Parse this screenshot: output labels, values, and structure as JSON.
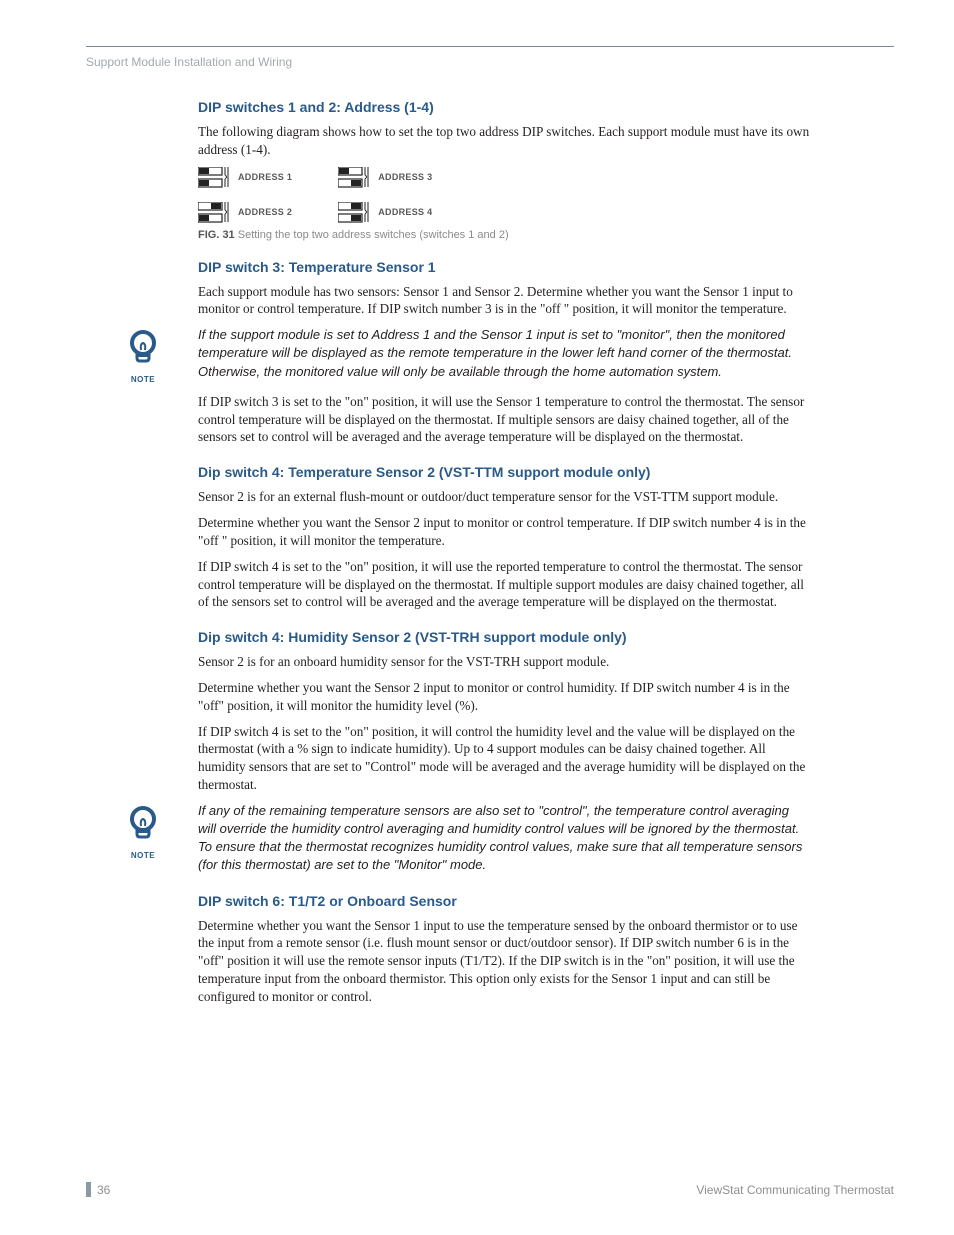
{
  "breadcrumb": "Support Module Installation and Wiring",
  "sections": {
    "s1": {
      "heading": "DIP switches 1 and 2: Address (1-4)",
      "p1": "The following diagram shows how to set the top two address DIP switches. Each support module must have its own address (1-4).",
      "addr1": "ADDRESS 1",
      "addr2": "ADDRESS 2",
      "addr3": "ADDRESS 3",
      "addr4": "ADDRESS 4",
      "fig_bold": "FIG. 31",
      "fig_rest": "  Setting the top two address switches (switches 1 and 2)"
    },
    "s2": {
      "heading": "DIP switch 3: Temperature Sensor 1",
      "p1": "Each support module has two sensors: Sensor 1 and Sensor 2. Determine whether you want the Sensor 1 input to monitor or control temperature.  If DIP switch number 3 is in the \"off \" position, it will monitor the temperature.",
      "note": "If the support module is set to Address 1 and the Sensor 1 input is set to \"monitor\", then the monitored temperature will be displayed as the remote temperature in the lower left hand corner of  the thermostat.  Otherwise, the monitored value will only be available through the home automation system.",
      "p2": "If DIP switch 3 is set to the \"on\" position, it will use the Sensor 1 temperature to control the thermostat. The sensor control temperature will be displayed on the thermostat. If multiple sensors are daisy chained together, all of the sensors set to control will be averaged and the average temperature will be displayed on the thermostat."
    },
    "s3": {
      "heading": "Dip switch 4: Temperature Sensor 2 (VST-TTM support module only)",
      "p1": "Sensor 2 is for an external flush-mount or outdoor/duct temperature sensor for the VST-TTM support module.",
      "p2": "Determine whether you want the Sensor 2 input to monitor or control temperature. If DIP switch number 4 is in the \"off \" position, it will monitor the temperature.",
      "p3": "If DIP switch 4 is set to the \"on\" position, it will use the reported temperature to control the thermostat.  The sensor control temperature will be displayed on the thermostat.  If multiple support modules are daisy chained together, all of the sensors set to control will be averaged and the average temperature will be displayed on the thermostat."
    },
    "s4": {
      "heading": "Dip switch 4: Humidity Sensor 2 (VST-TRH support module only)",
      "p1": "Sensor 2 is for an onboard humidity sensor for the VST-TRH support module.",
      "p2": "Determine whether you want the Sensor 2 input to monitor or control humidity. If DIP switch number 4 is in the \"off\" position, it will monitor the humidity level (%).",
      "p3": "If DIP switch 4 is set to the \"on\" position, it will control the humidity level and the value will be displayed on the thermostat (with a % sign to indicate humidity). Up to 4 support modules can be daisy chained together. All humidity sensors that are set to \"Control\" mode will be averaged and the average humidity will be displayed on the thermostat.",
      "note": "If any of the remaining temperature sensors are also set to \"control\", the temperature control averaging will override the humidity control averaging and humidity control values will be ignored by the thermostat. To ensure that the thermostat recognizes humidity control values, make sure that all temperature sensors (for this thermostat) are set to the \"Monitor\" mode."
    },
    "s5": {
      "heading": "DIP switch 6: T1/T2 or Onboard Sensor",
      "p1": "Determine whether you want the Sensor 1 input to use the temperature sensed by the onboard thermistor or to use the input from a remote sensor (i.e. flush mount sensor or duct/outdoor sensor).  If DIP switch number 6 is in the \"off\" position it will use the remote sensor inputs (T1/T2).  If the DIP switch is in the \"on\" position, it will use the temperature input from the onboard thermistor.  This option only exists for the Sensor 1 input and can still be configured to monitor or control."
    }
  },
  "note_label": "NOTE",
  "footer": {
    "page": "36",
    "doc": "ViewStat Communicating Thermostat"
  }
}
